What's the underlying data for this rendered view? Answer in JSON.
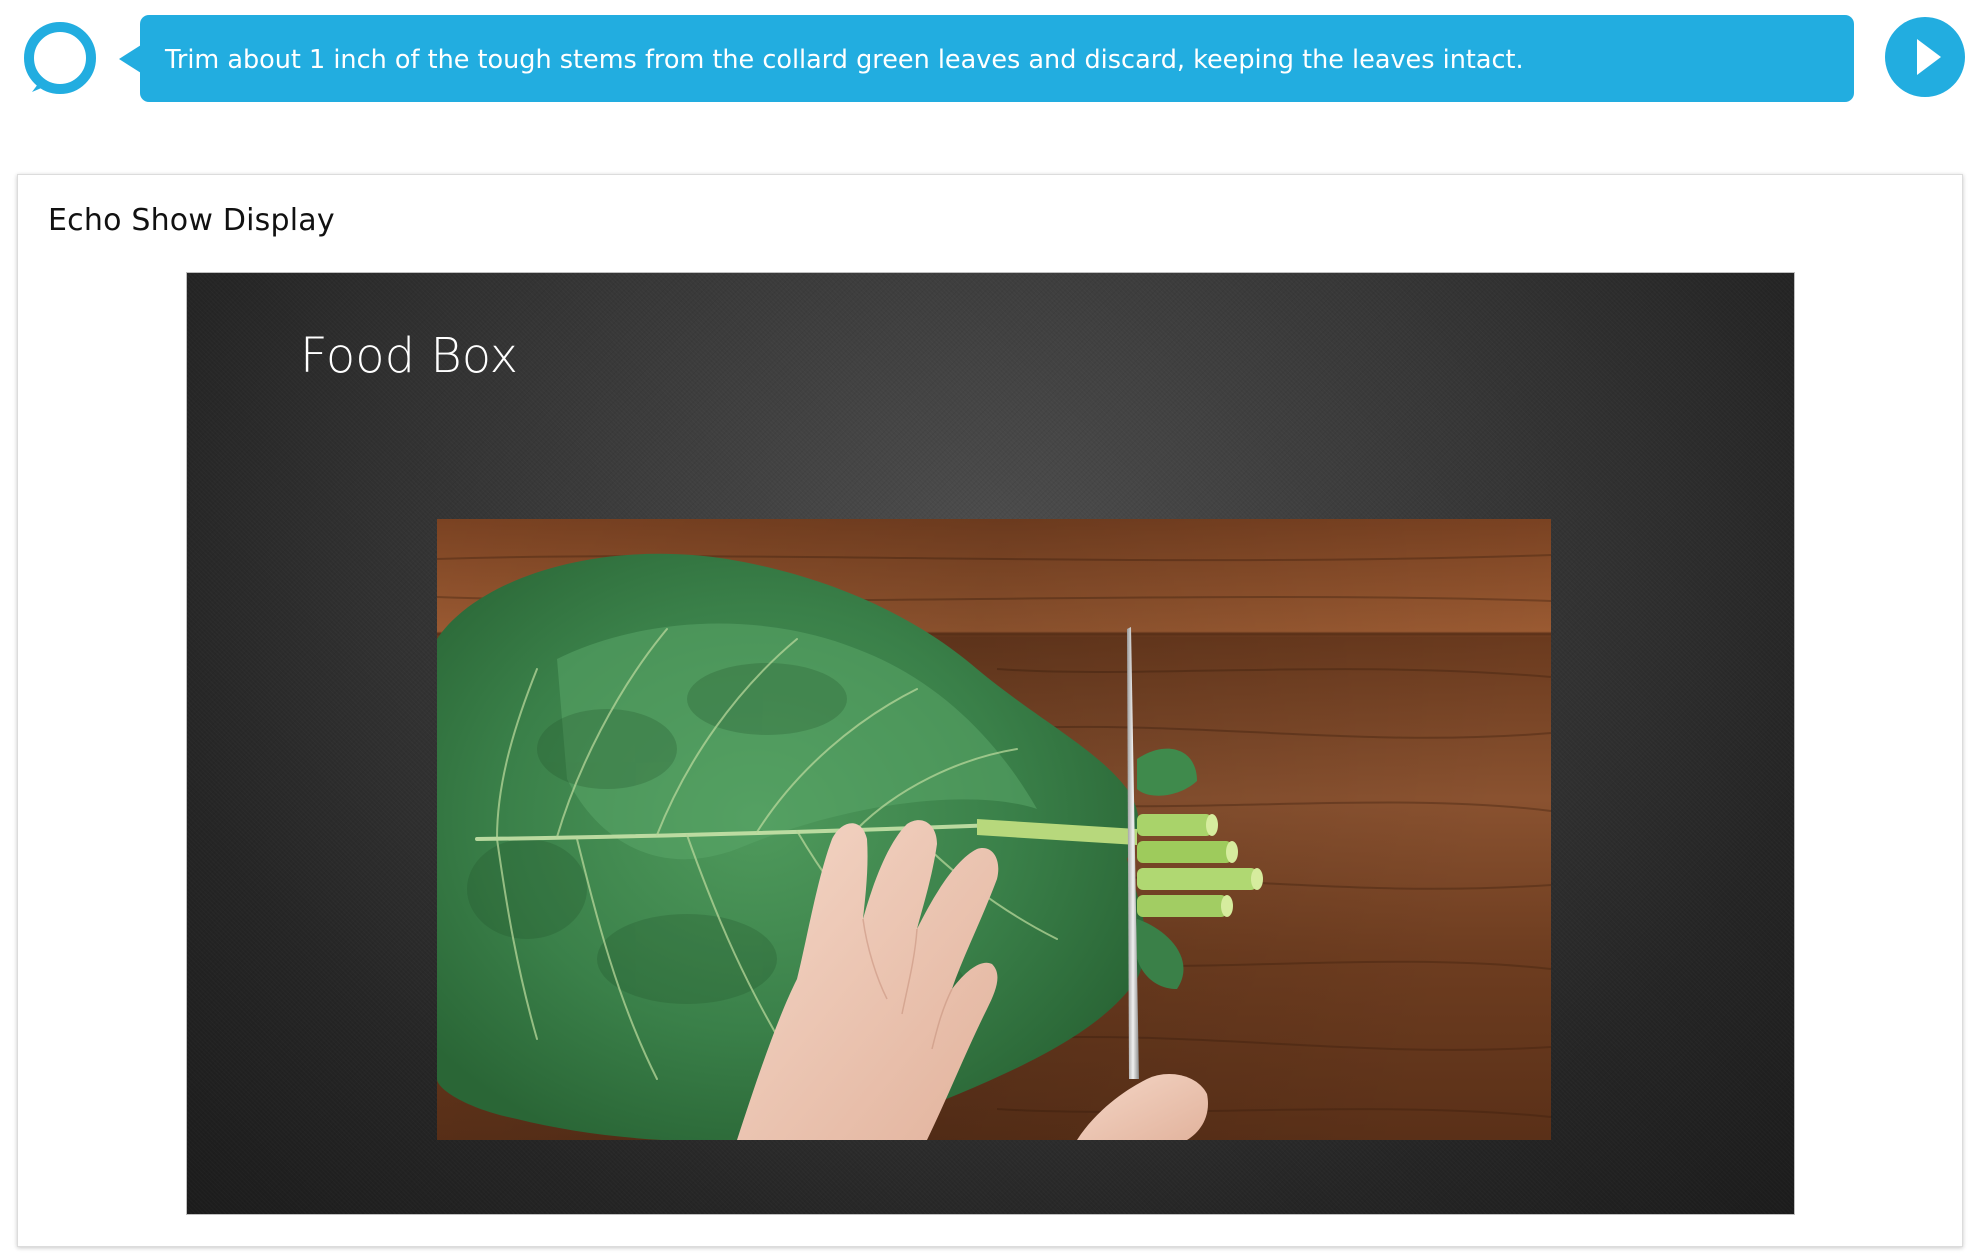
{
  "conversation": {
    "message": "Trim about 1 inch of the tough stems from the collard green leaves and discard, keeping the leaves intact.",
    "avatar_icon": "alexa-ring-icon",
    "play_icon": "play-icon",
    "accent_color": "#22ade0"
  },
  "card": {
    "title": "Echo Show Display"
  },
  "screen": {
    "title": "Food Box",
    "image": {
      "icon": "collard-greens-photo"
    }
  }
}
